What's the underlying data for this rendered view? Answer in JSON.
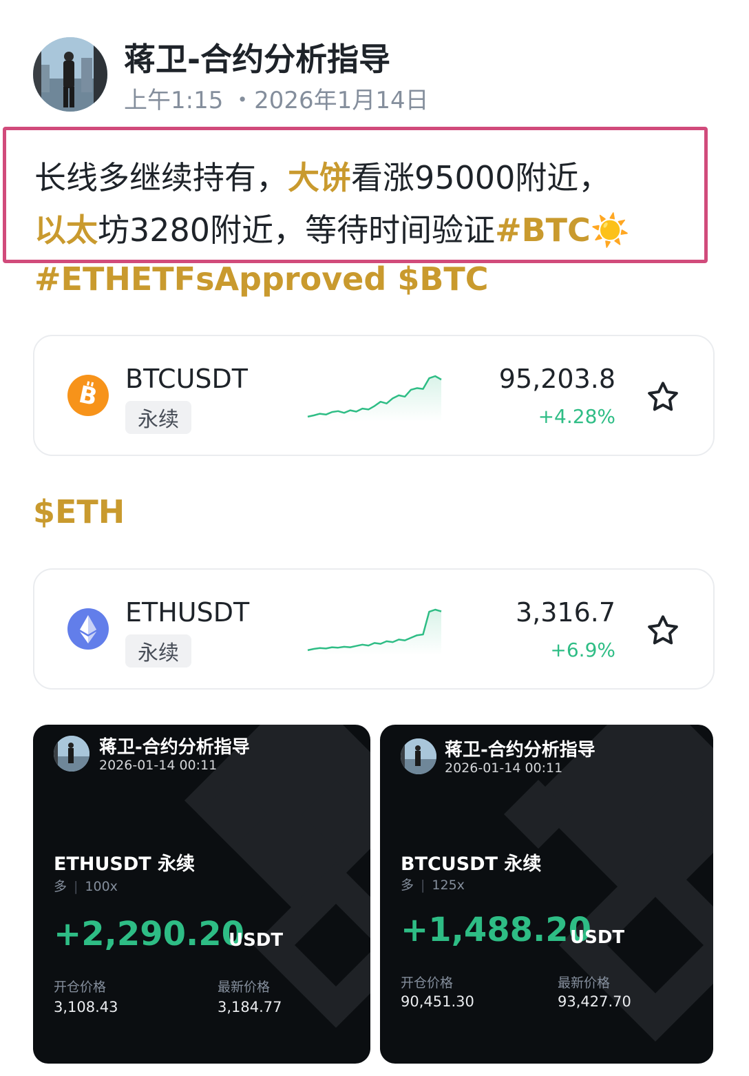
{
  "post": {
    "author": "蒋卫-合约分析指导",
    "time": "上午1:15 ・2026年1月14日",
    "line1_a": "长线多继续持有，",
    "line1_b": "大饼",
    "line1_c": "看涨95000附近，",
    "line2_a": "以太",
    "line2_b": "坊3280附近，等待时间验证",
    "line2_c": "#BTC☀️",
    "line3": "#ETHETFsApproved $BTC",
    "eth_tag": "$ETH"
  },
  "tickers": [
    {
      "symbol": "BTCUSDT",
      "badge": "永续",
      "price": "95,203.8",
      "change": "+4.28%",
      "icon": "bitcoin-icon",
      "icon_color": "#f7931a",
      "spark": [
        0.05,
        0.08,
        0.12,
        0.1,
        0.16,
        0.18,
        0.14,
        0.2,
        0.17,
        0.24,
        0.22,
        0.3,
        0.4,
        0.36,
        0.48,
        0.55,
        0.52,
        0.68,
        0.72,
        0.7,
        0.95,
        1.0,
        0.92
      ]
    },
    {
      "symbol": "ETHUSDT",
      "badge": "永续",
      "price": "3,316.7",
      "change": "+6.9%",
      "icon": "ethereum-icon",
      "icon_color": "#627eea",
      "spark": [
        0.05,
        0.08,
        0.1,
        0.09,
        0.12,
        0.11,
        0.13,
        0.12,
        0.15,
        0.18,
        0.16,
        0.22,
        0.2,
        0.26,
        0.24,
        0.3,
        0.28,
        0.34,
        0.4,
        0.42,
        0.95,
        1.0,
        0.96
      ]
    }
  ],
  "pnl_cards": [
    {
      "author": "蒋卫-合约分析指导",
      "date": "2026-01-14 00:11",
      "symbol": "ETHUSDT 永续",
      "side": "多",
      "leverage": "100x",
      "amount": "+2,290.20",
      "unit": "USDT",
      "open_label": "开仓价格",
      "open_value": "3,108.43",
      "last_label": "最新价格",
      "last_value": "3,184.77"
    },
    {
      "author": "蒋卫-合约分析指导",
      "date": "2026-01-14 00:11",
      "symbol": "BTCUSDT 永续",
      "side": "多",
      "leverage": "125x",
      "amount": "+1,488.20",
      "unit": "USDT",
      "open_label": "开仓价格",
      "open_value": "90,451.30",
      "last_label": "最新价格",
      "last_value": "93,427.70"
    }
  ],
  "colors": {
    "gold": "#c99a2e",
    "green": "#2ebd85",
    "highlight_border": "#d14b7b"
  }
}
